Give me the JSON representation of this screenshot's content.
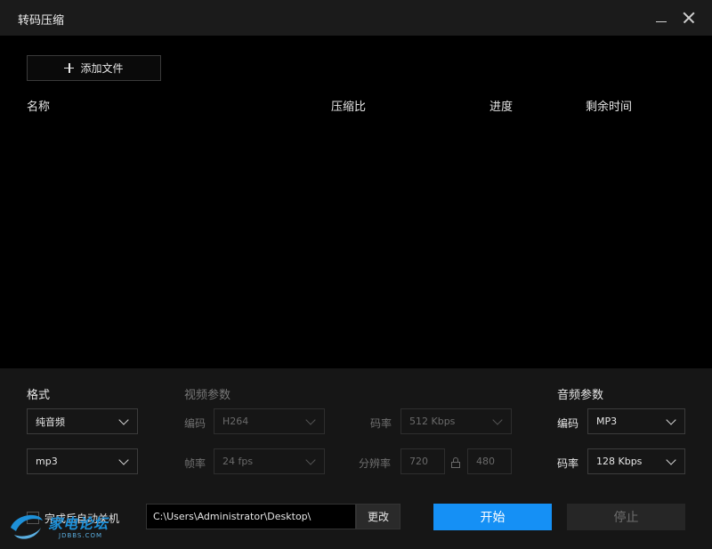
{
  "window": {
    "title": "转码压缩"
  },
  "list": {
    "add_file_label": "添加文件",
    "columns": [
      "名称",
      "压缩比",
      "进度",
      "剩余时间"
    ]
  },
  "format": {
    "title": "格式",
    "type_value": "纯音频",
    "ext_value": "mp3"
  },
  "video": {
    "title": "视频参数",
    "codec_label": "编码",
    "codec_value": "H264",
    "fps_label": "帧率",
    "fps_value": "24 fps",
    "bitrate_label": "码率",
    "bitrate_value": "512 Kbps",
    "resolution_label": "分辨率",
    "width_value": "720",
    "height_value": "480"
  },
  "audio": {
    "title": "音频参数",
    "codec_label": "编码",
    "codec_value": "MP3",
    "bitrate_label": "码率",
    "bitrate_value": "128 Kbps"
  },
  "bottom": {
    "shutdown_label": "完成后自动关机",
    "output_path": "C:\\Users\\Administrator\\Desktop\\",
    "change_label": "更改",
    "start_label": "开始",
    "stop_label": "停止"
  },
  "watermark": {
    "text": "家电论坛",
    "sub": "JDBBS.COM"
  },
  "colors": {
    "accent": "#1590f5",
    "background": "#000000",
    "panel": "#161616"
  }
}
